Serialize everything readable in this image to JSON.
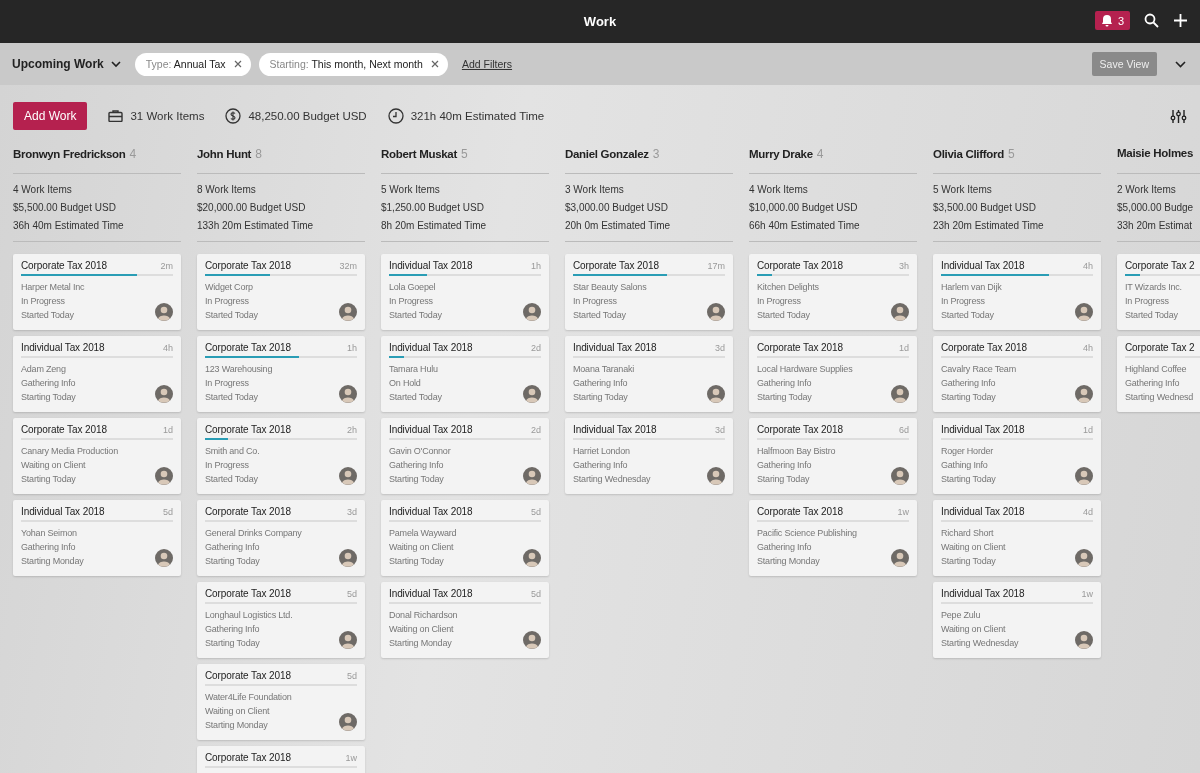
{
  "top_bar": {
    "title": "Work",
    "notifications": "3"
  },
  "filter_bar": {
    "view": "Upcoming Work",
    "filters": [
      {
        "label": "Type:",
        "value": "Annual Tax"
      },
      {
        "label": "Starting:",
        "value": "This month, Next month"
      }
    ],
    "add_filters": "Add Filters",
    "save_view": "Save View"
  },
  "toolbar": {
    "add_button": "Add Work",
    "work_items": "31 Work Items",
    "budget": "48,250.00 Budget USD",
    "time": "321h 40m Estimated Time"
  },
  "columns": [
    {
      "name": "Bronwyn Fredrickson",
      "count": "4",
      "stats": [
        "4 Work Items",
        "$5,500.00 Budget USD",
        "36h 40m Estimated Time"
      ],
      "cards": [
        {
          "title": "Corporate Tax 2018",
          "age": "2m",
          "client": "Harper Metal Inc",
          "status": "In Progress",
          "start": "Started Today",
          "level": 0.76
        },
        {
          "title": "Individual Tax 2018",
          "age": "4h",
          "client": "Adam Zeng",
          "status": "Gathering Info",
          "start": "Starting Today"
        },
        {
          "title": "Corporate Tax 2018",
          "age": "1d",
          "client": "Canary Media Production",
          "status": "Waiting on Client",
          "start": "Starting Today"
        },
        {
          "title": "Individual Tax 2018",
          "age": "5d",
          "client": "Yohan Seimon",
          "status": "Gathering Info",
          "start": "Starting Monday"
        }
      ]
    },
    {
      "name": "John Hunt",
      "count": "8",
      "stats": [
        "8 Work Items",
        "$20,000.00 Budget USD",
        "133h 20m Estimated Time"
      ],
      "cards": [
        {
          "title": "Corporate Tax 2018",
          "age": "32m",
          "client": "Widget Corp",
          "status": "In Progress",
          "start": "Started Today",
          "level": 0.43
        },
        {
          "title": "Corporate Tax 2018",
          "age": "1h",
          "client": "123 Warehousing",
          "status": "In Progress",
          "start": "Started Today",
          "level": 0.62
        },
        {
          "title": "Corporate Tax 2018",
          "age": "2h",
          "client": "Smith and Co.",
          "status": "In Progress",
          "start": "Started Today",
          "level": 0.15
        },
        {
          "title": "Corporate Tax 2018",
          "age": "3d",
          "client": "General Drinks Company",
          "status": "Gathering Info",
          "start": "Starting Today"
        },
        {
          "title": "Corporate Tax 2018",
          "age": "5d",
          "client": "Longhaul Logistics Ltd.",
          "status": "Gathering Info",
          "start": "Starting Today"
        },
        {
          "title": "Corporate Tax 2018",
          "age": "5d",
          "client": "Water4Life Foundation",
          "status": "Waiting on Client",
          "start": "Starting Monday"
        },
        {
          "title": "Corporate Tax 2018",
          "age": "1w"
        }
      ]
    },
    {
      "name": "Robert Muskat",
      "count": "5",
      "stats": [
        "5 Work Items",
        "$1,250.00 Budget USD",
        "8h 20m Estimated Time"
      ],
      "cards": [
        {
          "title": "Individual Tax 2018",
          "age": "1h",
          "client": "Lola Goepel",
          "status": "In Progress",
          "start": "Started Today",
          "level": 0.25
        },
        {
          "title": "Individual Tax 2018",
          "age": "2d",
          "client": "Tamara Hulu",
          "status": "On Hold",
          "start": "Started Today",
          "level": 0.1
        },
        {
          "title": "Individual Tax 2018",
          "age": "2d",
          "client": "Gavin O'Connor",
          "status": "Gathering Info",
          "start": "Starting Today"
        },
        {
          "title": "Individual Tax 2018",
          "age": "5d",
          "client": "Pamela Wayward",
          "status": "Waiting on Client",
          "start": "Starting Today"
        },
        {
          "title": "Individual Tax 2018",
          "age": "5d",
          "client": "Donal Richardson",
          "status": "Waiting on Client",
          "start": "Starting Monday"
        }
      ]
    },
    {
      "name": "Daniel Gonzalez",
      "count": "3",
      "stats": [
        "3 Work Items",
        "$3,000.00 Budget USD",
        "20h 0m Estimated Time"
      ],
      "cards": [
        {
          "title": "Corporate Tax 2018",
          "age": "17m",
          "client": "Star Beauty Salons",
          "status": "In Progress",
          "start": "Started Today",
          "level": 0.62
        },
        {
          "title": "Individual Tax 2018",
          "age": "3d",
          "client": "Moana Taranaki",
          "status": "Gathering Info",
          "start": "Starting Today"
        },
        {
          "title": "Individual Tax 2018",
          "age": "3d",
          "client": "Harriet London",
          "status": "Gathering Info",
          "start": "Starting Wednesday"
        }
      ]
    },
    {
      "name": "Murry Drake",
      "count": "4",
      "stats": [
        "4 Work Items",
        "$10,000.00 Budget USD",
        "66h 40m Estimated Time"
      ],
      "cards": [
        {
          "title": "Corporate Tax 2018",
          "age": "3h",
          "client": "Kitchen Delights",
          "status": "In Progress",
          "start": "Started Today",
          "level": 0.1
        },
        {
          "title": "Corporate Tax 2018",
          "age": "1d",
          "client": "Local Hardware Supplies",
          "status": "Gathering Info",
          "start": "Starting Today"
        },
        {
          "title": "Corporate Tax 2018",
          "age": "6d",
          "client": "Halfmoon Bay Bistro",
          "status": "Gathering Info",
          "start": "Staring Today"
        },
        {
          "title": "Corporate Tax 2018",
          "age": "1w",
          "client": "Pacific Science Publishing",
          "status": "Gathering Info",
          "start": "Starting Monday"
        }
      ]
    },
    {
      "name": "Olivia Clifford",
      "count": "5",
      "stats": [
        "5 Work Items",
        "$3,500.00 Budget USD",
        "23h 20m Estimated Time"
      ],
      "cards": [
        {
          "title": "Individual Tax 2018",
          "age": "4h",
          "client": "Harlem van Dijk",
          "status": "In Progress",
          "start": "Started Today",
          "level": 0.71
        },
        {
          "title": "Corporate Tax 2018",
          "age": "4h",
          "client": "Cavalry Race Team",
          "status": "Gathering Info",
          "start": "Starting Today"
        },
        {
          "title": "Individual Tax 2018",
          "age": "1d",
          "client": "Roger Horder",
          "status": "Gathing Info",
          "start": "Starting Today"
        },
        {
          "title": "Individual Tax 2018",
          "age": "4d",
          "client": "Richard Short",
          "status": "Waiting on Client",
          "start": "Starting Today"
        },
        {
          "title": "Individual Tax 2018",
          "age": "1w",
          "client": "Pepe Zulu",
          "status": "Waiting on Client",
          "start": "Starting Wednesday"
        }
      ]
    },
    {
      "name": "Maisie Holmes",
      "stats": [
        "2 Work Items",
        "$5,000.00 Budge",
        "33h 20m Estimat"
      ],
      "cards": [
        {
          "title": "Corporate Tax 2",
          "client": "IT Wizards Inc.",
          "status": "In Progress",
          "start": "Started Today",
          "level": 0.1,
          "avatar": false
        },
        {
          "title": "Corporate Tax 2",
          "client": "Highland Coffee",
          "status": "Gathering Info",
          "start": "Starting Wednesd",
          "avatar": false
        }
      ]
    }
  ]
}
